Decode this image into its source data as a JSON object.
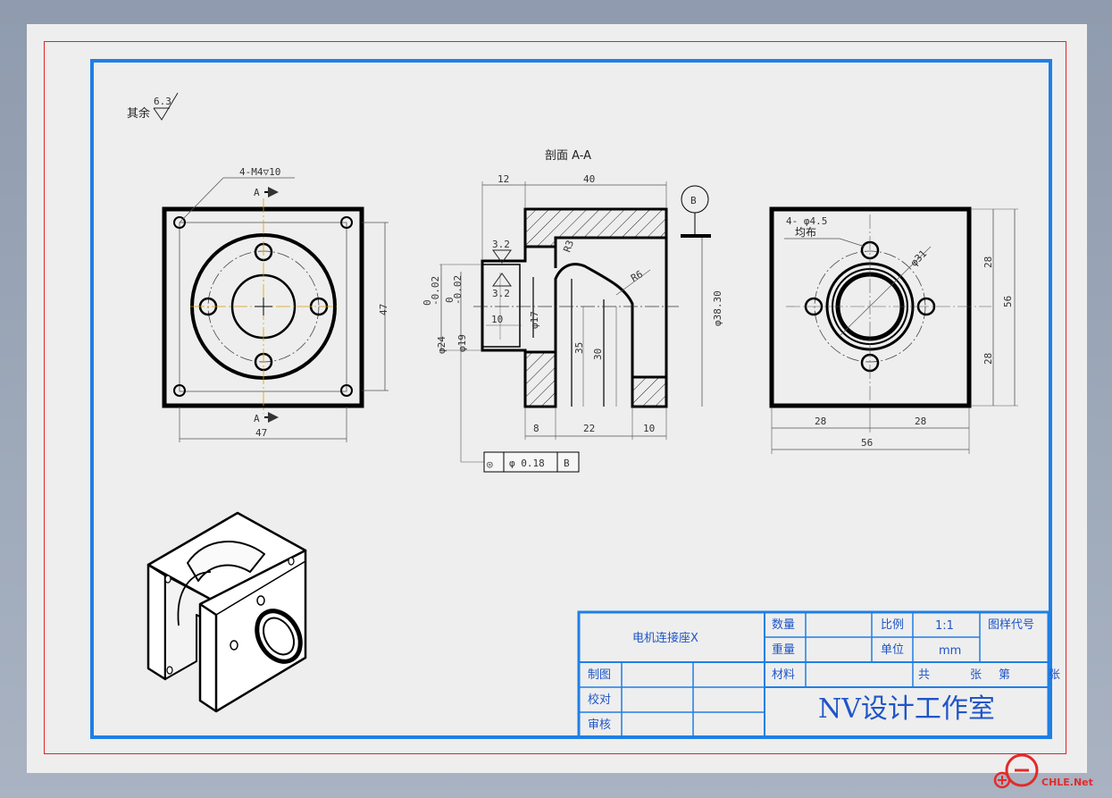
{
  "drawing": {
    "surface_finish": {
      "prefix": "其余",
      "value": "6.3"
    },
    "front_view": {
      "thread_note": "4-M4▽10",
      "section_mark": "A",
      "dim_width": "47",
      "dim_height": "47"
    },
    "section_view": {
      "title": "剖面 A-A",
      "datum": "B",
      "roughness": [
        "3.2",
        "3.2"
      ],
      "dims_top": [
        "12",
        "40"
      ],
      "dims_bottom": [
        "8",
        "22",
        "10"
      ],
      "dim_phi24": "φ24",
      "tol_phi24": [
        "0",
        "-0.02"
      ],
      "dim_phi19": "φ19",
      "tol_phi19": [
        "0",
        "-0.02"
      ],
      "dim_phi17": "φ17",
      "dim_10": "10",
      "dim_35": "35",
      "dim_30": "30",
      "dim_phi38": "φ38.30",
      "dim_r6": "R6",
      "dim_r3": "R3",
      "tolerance_frame": {
        "symbol": "◎",
        "value": "φ 0.18",
        "datum": "B"
      }
    },
    "side_view": {
      "hole_note": "4- φ4.5",
      "hole_note2": "均布",
      "dim_phi31": "φ31",
      "dims_right": [
        "28",
        "56",
        "28"
      ],
      "dims_bottom": [
        "28",
        "28",
        "56"
      ]
    }
  },
  "title_block": {
    "part_name": "电机连接座X",
    "quantity_label": "数量",
    "weight_label": "重量",
    "scale_label": "比例",
    "scale_value": "1:1",
    "drawing_code_label": "图样代号",
    "unit_label": "单位",
    "unit_value": "mm",
    "material_label": "材料",
    "sheets_text": [
      "共",
      "张",
      "第",
      "张"
    ],
    "drawn_label": "制图",
    "checked_label": "校对",
    "approved_label": "审核",
    "studio": "NV设计工作室"
  },
  "watermark": "CHLE.Net",
  "colors": {
    "frame_red": "#e0242a",
    "frame_blue": "#1f7fe6",
    "title_text": "#1f55c8",
    "center_line": "#d8a000"
  }
}
